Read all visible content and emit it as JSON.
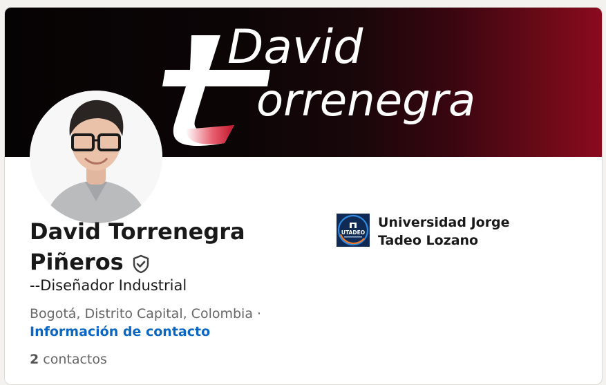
{
  "banner": {
    "line1": "David",
    "line2": "orrenegra",
    "accent": "#8a0a1e"
  },
  "profile": {
    "name_line1": "David Torrenegra",
    "name_line2": "Piñeros",
    "verified_icon": "shield-check-icon",
    "headline": "--Diseñador Industrial",
    "location": "Bogotá, Distrito Capital, Colombia ·",
    "contact_link": "Información de contacto",
    "connections_count": "2",
    "connections_label": "contactos"
  },
  "education": {
    "logo_text": "UTADEO",
    "name": "Universidad Jorge Tadeo Lozano"
  },
  "colors": {
    "link": "#0a66c2",
    "text": "#191919",
    "muted": "#666666"
  }
}
